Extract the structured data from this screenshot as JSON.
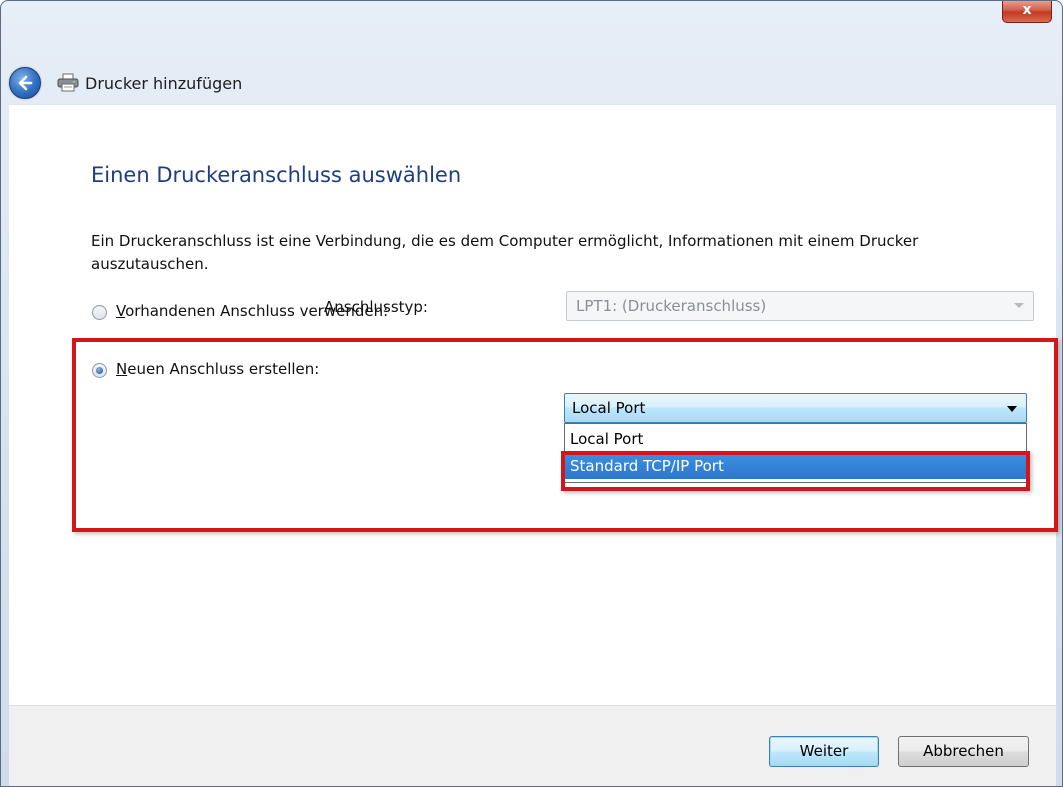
{
  "window": {
    "title": "Drucker hinzufügen",
    "close_label": "x"
  },
  "page": {
    "heading": "Einen Druckeranschluss auswählen",
    "description": "Ein Druckeranschluss ist eine Verbindung, die es dem Computer ermöglicht, Informationen mit einem Drucker auszutauschen."
  },
  "options": {
    "existing": {
      "accel": "V",
      "label_rest": "orhandenen Anschluss verwenden:",
      "checked": false,
      "select_value": "LPT1: (Druckeranschluss)"
    },
    "new": {
      "accel": "N",
      "label_rest": "euen Anschluss erstellen:",
      "checked": true
    }
  },
  "port_type": {
    "label": "Anschlusstyp:",
    "selected": "Local Port",
    "items": [
      "Local Port",
      "Standard TCP/IP Port"
    ],
    "highlighted_index": 1
  },
  "buttons": {
    "next": "Weiter",
    "cancel": "Abbrechen"
  },
  "colors": {
    "heading": "#1f3d82",
    "annotation_red": "#d2161a",
    "selection_blue": "#3383d8"
  }
}
